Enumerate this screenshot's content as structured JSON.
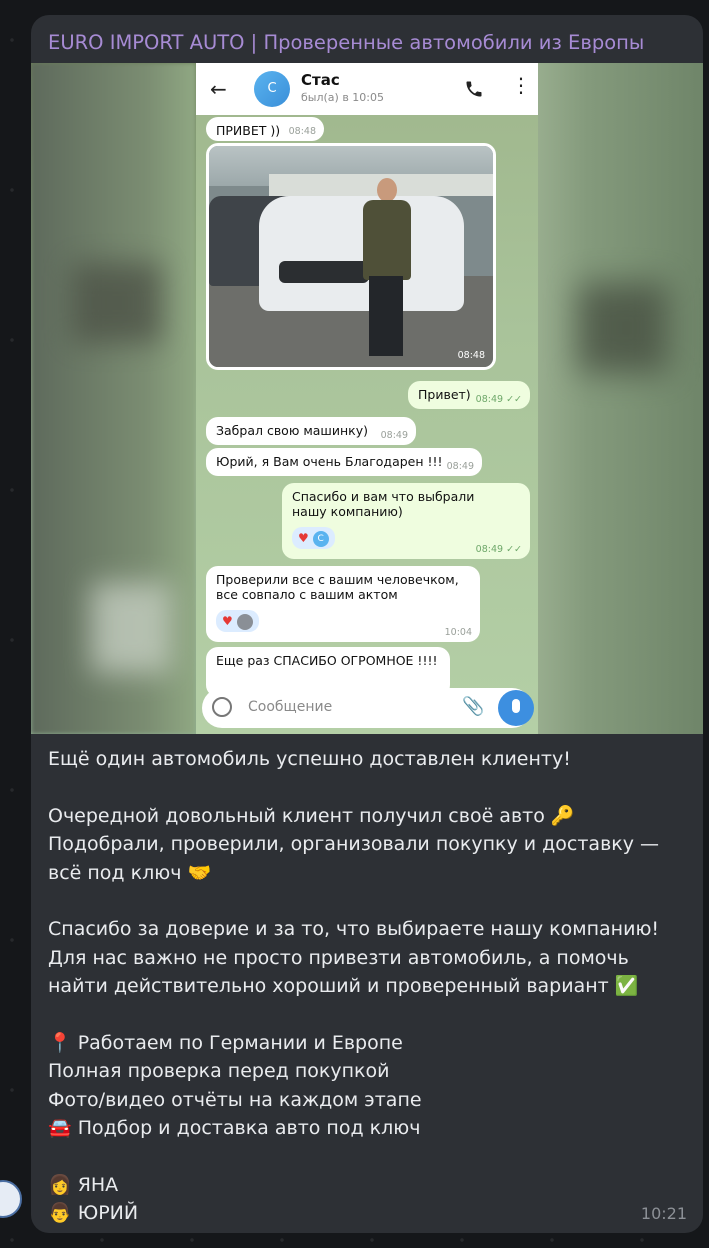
{
  "channel": {
    "title": "EURO IMPORT AUTO | Проверенные автомобили из Европы"
  },
  "chat": {
    "contact_name": "Стас",
    "contact_initial": "С",
    "last_seen": "был(а) в 10:05",
    "messages": [
      {
        "text": "ПРИВЕТ ))",
        "time": "08:48",
        "dir": "in"
      },
      {
        "text": "",
        "time": "08:48",
        "dir": "in",
        "type": "photo"
      },
      {
        "text": "Привет)",
        "time": "08:49",
        "dir": "out"
      },
      {
        "text": "Забрал свою машинку)",
        "time": "08:49",
        "dir": "in"
      },
      {
        "text": "Юрий, я Вам очень Благодарен !!!",
        "time": "08:49",
        "dir": "in"
      },
      {
        "text": "Спасибо и вам что выбрали нашу компанию)",
        "time": "08:49",
        "dir": "out"
      },
      {
        "text": "Проверили все с вашим человечком, все совпало с вашим актом",
        "time": "10:04",
        "dir": "in"
      },
      {
        "text": "Еще раз СПАСИБО ОГРОМНОЕ !!!!",
        "time": "",
        "dir": "in"
      }
    ],
    "composer_placeholder": "Сообщение"
  },
  "post": {
    "lines": [
      "Ещё один автомобиль успешно доставлен клиенту!",
      "Очередной довольный клиент получил своё авто 🔑",
      "Подобрали, проверили, организовали покупку и доставку — всё под ключ 🤝",
      "Спасибо за доверие и за то, что выбираете нашу компанию!",
      "Для нас важно не просто привезти автомобиль, а помочь найти действительно хороший и проверенный вариант ✅",
      "📍 Работаем по Германии и Европе",
      " Полная проверка перед покупкой",
      "Фото/видео отчёты на каждом этапе",
      "🚘 Подбор и доставка авто под ключ",
      "👩 ЯНА",
      "👨 ЮРИЙ"
    ],
    "time": "10:21"
  }
}
